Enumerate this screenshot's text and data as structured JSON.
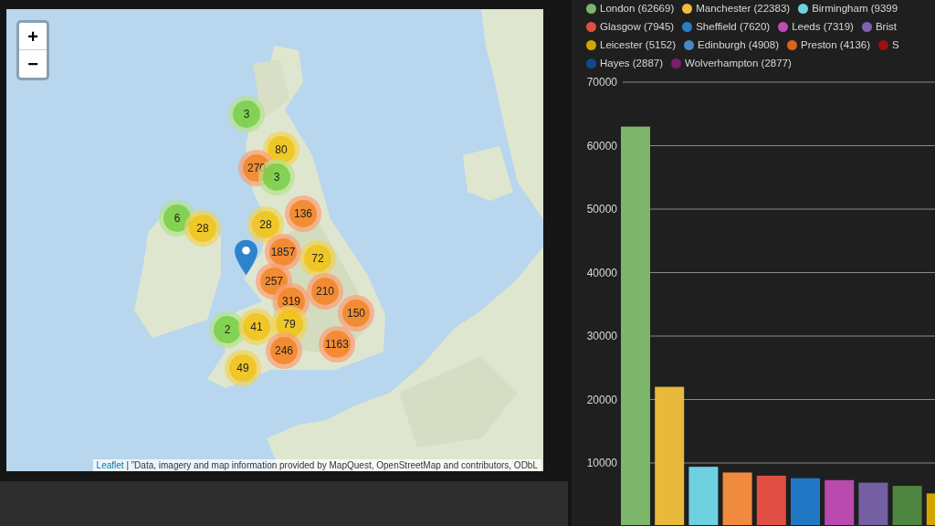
{
  "map": {
    "zoom_in": "+",
    "zoom_out": "−",
    "clusters": [
      {
        "count": "3",
        "kind": "small"
      },
      {
        "count": "80",
        "kind": "medium"
      },
      {
        "count": "270",
        "kind": "large"
      },
      {
        "count": "3",
        "kind": "small"
      },
      {
        "count": "6",
        "kind": "small"
      },
      {
        "count": "28",
        "kind": "medium"
      },
      {
        "count": "28",
        "kind": "medium"
      },
      {
        "count": "136",
        "kind": "large"
      },
      {
        "count": "1857",
        "kind": "large"
      },
      {
        "count": "72",
        "kind": "medium"
      },
      {
        "count": "257",
        "kind": "large"
      },
      {
        "count": "319",
        "kind": "large"
      },
      {
        "count": "210",
        "kind": "large"
      },
      {
        "count": "150",
        "kind": "large"
      },
      {
        "count": "2",
        "kind": "small"
      },
      {
        "count": "41",
        "kind": "medium"
      },
      {
        "count": "79",
        "kind": "medium"
      },
      {
        "count": "246",
        "kind": "large"
      },
      {
        "count": "1163",
        "kind": "large"
      },
      {
        "count": "49",
        "kind": "medium"
      }
    ],
    "attribution": {
      "link": "Leaflet",
      "text": " | ”Data, imagery and map information provided by MapQuest, OpenStreetMap and contributors, ODbL"
    }
  },
  "legend": {
    "rows": [
      [
        {
          "label": "London (62669)",
          "color": "#7db56b"
        },
        {
          "label": "Manchester (22383)",
          "color": "#f0bc3c"
        },
        {
          "label": "Birmingham (9399",
          "color": "#6fd0e0"
        }
      ],
      [
        {
          "label": "Glasgow (7945)",
          "color": "#e04f43"
        },
        {
          "label": "Sheffield (7620)",
          "color": "#2a7fc8"
        },
        {
          "label": "Leeds (7319)",
          "color": "#c04cb8"
        },
        {
          "label": "Brist",
          "color": "#7d62b0"
        }
      ],
      [
        {
          "label": "Leicester (5152)",
          "color": "#d4a500"
        },
        {
          "label": "Edinburgh (4908)",
          "color": "#4a86c8"
        },
        {
          "label": "Preston (4136)",
          "color": "#d8641c"
        },
        {
          "label": "S",
          "color": "#9a1010"
        }
      ],
      [
        {
          "label": "Hayes (2887)",
          "color": "#0e4a8a"
        },
        {
          "label": "Wolverhampton (2877)",
          "color": "#7a1e6e"
        }
      ]
    ]
  },
  "chart_data": {
    "type": "bar",
    "grid": true,
    "ylim": [
      0,
      70000
    ],
    "yticks": [
      10000,
      20000,
      30000,
      40000,
      50000,
      60000,
      70000
    ],
    "values": [
      63000,
      22000,
      9400,
      8500,
      8000,
      7600,
      7300,
      6900,
      6400,
      5200
    ],
    "colors": [
      "#7db56b",
      "#e8b93a",
      "#6fd0e0",
      "#ef8a3f",
      "#e04f43",
      "#2277c4",
      "#b84aad",
      "#735fa1",
      "#4e8540",
      "#d4a500"
    ]
  }
}
